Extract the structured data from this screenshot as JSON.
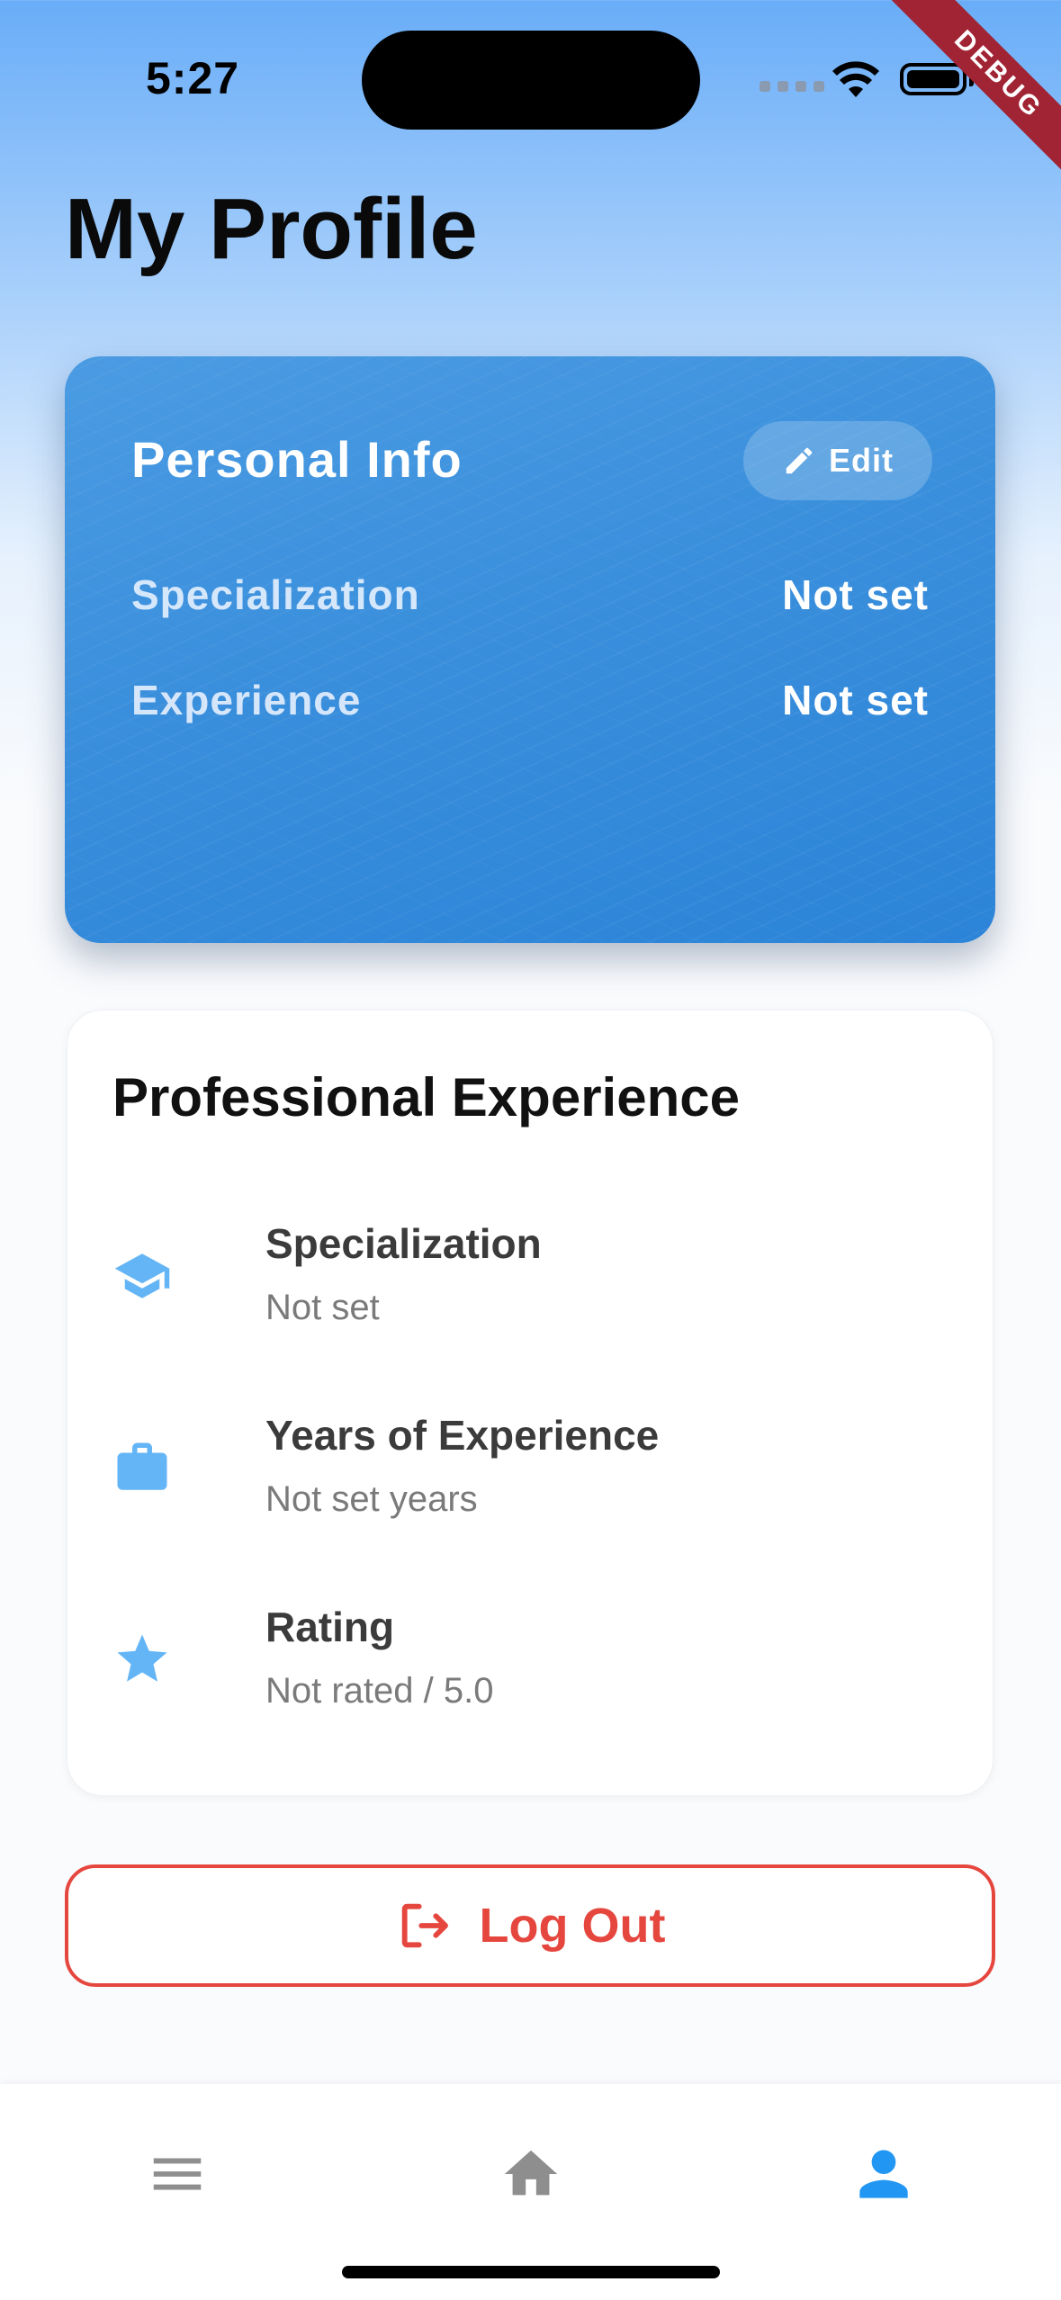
{
  "status_bar": {
    "time": "5:27"
  },
  "debug_banner": "DEBUG",
  "page": {
    "title": "My Profile"
  },
  "personal_info": {
    "title": "Personal Info",
    "edit_label": "Edit",
    "rows": [
      {
        "label": "Specialization",
        "value": "Not set"
      },
      {
        "label": "Experience",
        "value": "Not set"
      }
    ]
  },
  "professional": {
    "title": "Professional Experience",
    "items": [
      {
        "icon": "graduation-cap-icon",
        "title": "Specialization",
        "value": "Not set"
      },
      {
        "icon": "briefcase-icon",
        "title": "Years of Experience",
        "value": "Not set years"
      },
      {
        "icon": "star-icon",
        "title": "Rating",
        "value": "Not rated / 5.0"
      }
    ]
  },
  "logout": {
    "label": "Log Out"
  },
  "bottom_nav": {
    "items": [
      {
        "icon": "menu-icon",
        "active": false
      },
      {
        "icon": "home-icon",
        "active": false
      },
      {
        "icon": "person-icon",
        "active": true
      }
    ]
  },
  "colors": {
    "accent": "#2196f3",
    "icon_blue": "#64b5f6",
    "danger": "#e5473f",
    "inactive": "#8e8e8e"
  }
}
